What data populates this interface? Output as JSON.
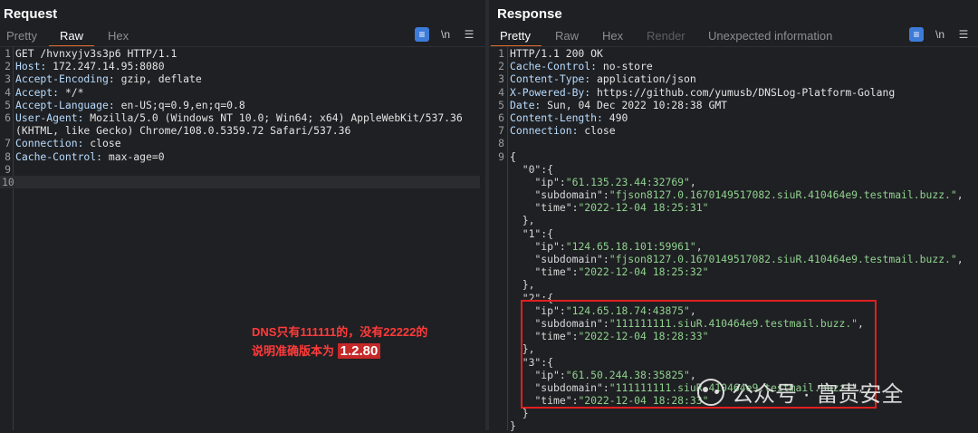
{
  "request": {
    "title": "Request",
    "tabs": [
      "Pretty",
      "Raw",
      "Hex"
    ],
    "active_tab": "Raw",
    "lines": [
      {
        "n": "1",
        "k": "",
        "v": "GET /hvnxyjv3s3p6 HTTP/1.1"
      },
      {
        "n": "2",
        "k": "Host:",
        "v": " 172.247.14.95:8080"
      },
      {
        "n": "3",
        "k": "Accept-Encoding:",
        "v": " gzip, deflate"
      },
      {
        "n": "4",
        "k": "Accept:",
        "v": " */*"
      },
      {
        "n": "5",
        "k": "Accept-Language:",
        "v": " en-US;q=0.9,en;q=0.8"
      },
      {
        "n": "6",
        "k": "User-Agent:",
        "v": " Mozilla/5.0 (Windows NT 10.0; Win64; x64) AppleWebKit/537.36"
      },
      {
        "n": "",
        "k": "",
        "v": "(KHTML, like Gecko) Chrome/108.0.5359.72 Safari/537.36"
      },
      {
        "n": "7",
        "k": "Connection:",
        "v": " close"
      },
      {
        "n": "8",
        "k": "Cache-Control:",
        "v": " max-age=0"
      },
      {
        "n": "9",
        "k": "",
        "v": ""
      },
      {
        "n": "10",
        "k": "",
        "v": ""
      }
    ]
  },
  "response": {
    "title": "Response",
    "tabs": [
      "Pretty",
      "Raw",
      "Hex",
      "Render",
      "Unexpected information"
    ],
    "active_tab": "Pretty",
    "lines": [
      {
        "n": "1",
        "k": "",
        "v": "HTTP/1.1 200 OK"
      },
      {
        "n": "2",
        "k": "Cache-Control:",
        "v": " no-store"
      },
      {
        "n": "3",
        "k": "Content-Type:",
        "v": " application/json"
      },
      {
        "n": "4",
        "k": "X-Powered-By:",
        "v": " https://github.com/yumusb/DNSLog-Platform-Golang"
      },
      {
        "n": "5",
        "k": "Date:",
        "v": " Sun, 04 Dec 2022 10:28:38 GMT"
      },
      {
        "n": "6",
        "k": "Content-Length:",
        "v": " 490"
      },
      {
        "n": "7",
        "k": "Connection:",
        "v": " close"
      },
      {
        "n": "8",
        "k": "",
        "v": ""
      },
      {
        "n": "9",
        "k": "",
        "v": "{"
      }
    ],
    "json_lines": [
      {
        "ind": "  ",
        "key": "\"0\"",
        "rest": ":{"
      },
      {
        "ind": "    ",
        "key": "\"ip\"",
        "sep": ":",
        "val": "\"61.135.23.44:32769\"",
        "end": ","
      },
      {
        "ind": "    ",
        "key": "\"subdomain\"",
        "sep": ":",
        "val": "\"fjson8127.0.1670149517082.siuR.410464e9.testmail.buzz.\"",
        "end": ","
      },
      {
        "ind": "    ",
        "key": "\"time\"",
        "sep": ":",
        "val": "\"2022-12-04 18:25:31\"",
        "end": ""
      },
      {
        "ind": "  ",
        "key": "",
        "rest": "},"
      },
      {
        "ind": "  ",
        "key": "\"1\"",
        "rest": ":{"
      },
      {
        "ind": "    ",
        "key": "\"ip\"",
        "sep": ":",
        "val": "\"124.65.18.101:59961\"",
        "end": ","
      },
      {
        "ind": "    ",
        "key": "\"subdomain\"",
        "sep": ":",
        "val": "\"fjson8127.0.1670149517082.siuR.410464e9.testmail.buzz.\"",
        "end": ","
      },
      {
        "ind": "    ",
        "key": "\"time\"",
        "sep": ":",
        "val": "\"2022-12-04 18:25:32\"",
        "end": ""
      },
      {
        "ind": "  ",
        "key": "",
        "rest": "},"
      },
      {
        "ind": "  ",
        "key": "\"2\"",
        "rest": ":{"
      },
      {
        "ind": "    ",
        "key": "\"ip\"",
        "sep": ":",
        "val": "\"124.65.18.74:43875\"",
        "end": ","
      },
      {
        "ind": "    ",
        "key": "\"subdomain\"",
        "sep": ":",
        "val": "\"111111111.siuR.410464e9.testmail.buzz.\"",
        "end": ","
      },
      {
        "ind": "    ",
        "key": "\"time\"",
        "sep": ":",
        "val": "\"2022-12-04 18:28:33\"",
        "end": ""
      },
      {
        "ind": "  ",
        "key": "",
        "rest": "},"
      },
      {
        "ind": "  ",
        "key": "\"3\"",
        "rest": ":{"
      },
      {
        "ind": "    ",
        "key": "\"ip\"",
        "sep": ":",
        "val": "\"61.50.244.38:35825\"",
        "end": ","
      },
      {
        "ind": "    ",
        "key": "\"subdomain\"",
        "sep": ":",
        "val": "\"111111111.siuR.410464e9.testmail.buzz.\"",
        "end": ","
      },
      {
        "ind": "    ",
        "key": "\"time\"",
        "sep": ":",
        "val": "\"2022-12-04 18:28:33\"",
        "end": ""
      },
      {
        "ind": "  ",
        "key": "",
        "rest": "}"
      },
      {
        "ind": "",
        "key": "",
        "rest": "}"
      }
    ]
  },
  "annotation": {
    "line1": "DNS只有111111的，没有22222的",
    "line2_prefix": "说明准确版本为",
    "version": "1.2.80"
  },
  "watermark": "公众号 · 富贵安全",
  "icons": {
    "pretty_toggle": "wrap-lines-icon",
    "newline": "newline-icon",
    "menu": "menu-icon"
  },
  "colors": {
    "background": "#1f2023",
    "accent": "#e06c2b",
    "tool_blue": "#3d7bd8",
    "annotation_red": "#ff3b3b"
  }
}
